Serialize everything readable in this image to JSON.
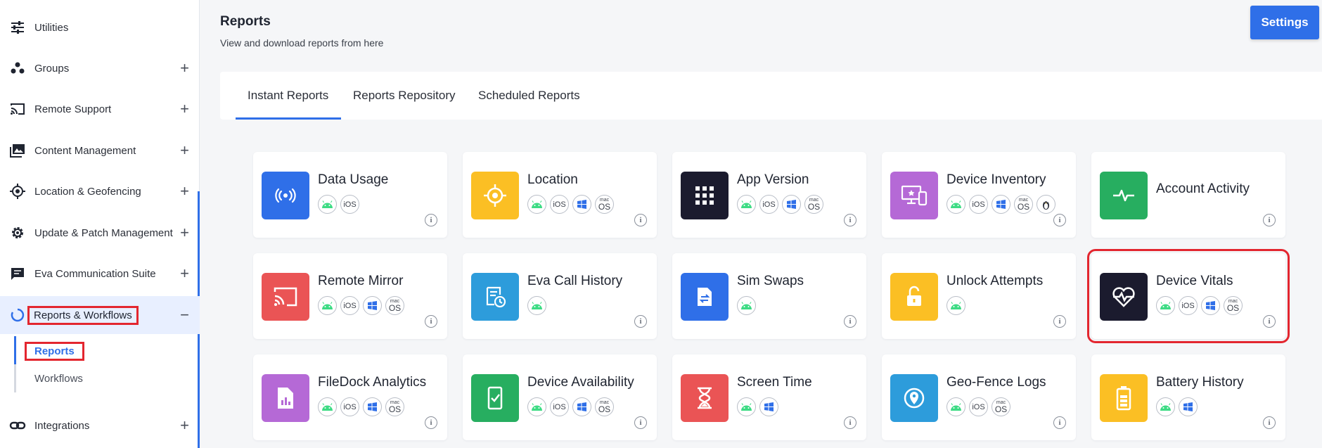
{
  "sidebar": {
    "items": [
      {
        "label": "Utilities",
        "icon": "sliders-icon",
        "expand": ""
      },
      {
        "label": "Groups",
        "icon": "groups-icon",
        "expand": "+"
      },
      {
        "label": "Remote Support",
        "icon": "cast-icon",
        "expand": "+"
      },
      {
        "label": "Content Management",
        "icon": "images-icon",
        "expand": "+"
      },
      {
        "label": "Location & Geofencing",
        "icon": "crosshair-icon",
        "expand": "+"
      },
      {
        "label": "Update & Patch Management",
        "icon": "gear-icon",
        "expand": "+"
      },
      {
        "label": "Eva Communication Suite",
        "icon": "chat-icon",
        "expand": "+"
      },
      {
        "label": "Reports & Workflows",
        "icon": "spinner-icon",
        "expand": "−"
      },
      {
        "label": "Integrations",
        "icon": "link-icon",
        "expand": "+"
      }
    ],
    "subitems": [
      {
        "label": "Reports"
      },
      {
        "label": "Workflows"
      }
    ]
  },
  "header": {
    "title": "Reports",
    "subtitle": "View and download reports from here",
    "settings_label": "Settings"
  },
  "tabs": [
    {
      "label": "Instant Reports"
    },
    {
      "label": "Reports Repository"
    },
    {
      "label": "Scheduled Reports"
    }
  ],
  "platform_labels": {
    "ios": "iOS",
    "mac_small": "mac",
    "mac_big": "OS"
  },
  "colors": {
    "accent": "#2f6fe8",
    "highlight": "#e3262f",
    "blue": "#2f6fe8",
    "yellow": "#fbbf24",
    "dark": "#1b1b2e",
    "purple": "#b569d6",
    "green": "#27ae60",
    "red": "#ea5455",
    "lightblue": "#2d9cdb",
    "android": "#3ddc84"
  },
  "info_glyph": "i",
  "cards": [
    {
      "title": "Data Usage",
      "color": "blue",
      "icon": "signal-broadcast-icon",
      "platforms": [
        "android",
        "ios"
      ]
    },
    {
      "title": "Location",
      "color": "yellow",
      "icon": "target-icon",
      "platforms": [
        "android",
        "ios",
        "windows",
        "macos"
      ]
    },
    {
      "title": "App Version",
      "color": "dark",
      "icon": "app-grid-icon",
      "platforms": [
        "android",
        "ios",
        "windows",
        "macos"
      ]
    },
    {
      "title": "Device Inventory",
      "color": "purple",
      "icon": "devices-icon",
      "platforms": [
        "android",
        "ios",
        "windows",
        "macos",
        "linux"
      ]
    },
    {
      "title": "Account Activity",
      "color": "green",
      "icon": "pulse-icon",
      "platforms": []
    },
    {
      "title": "Remote Mirror",
      "color": "red",
      "icon": "cast-icon",
      "platforms": [
        "android",
        "ios",
        "windows",
        "macos"
      ]
    },
    {
      "title": "Eva Call History",
      "color": "lightblue",
      "icon": "call-history-icon",
      "platforms": [
        "android"
      ]
    },
    {
      "title": "Sim Swaps",
      "color": "blue",
      "icon": "sim-swap-icon",
      "platforms": [
        "android"
      ]
    },
    {
      "title": "Unlock Attempts",
      "color": "yellow",
      "icon": "unlock-icon",
      "platforms": [
        "android"
      ]
    },
    {
      "title": "Device Vitals",
      "color": "dark",
      "icon": "heart-pulse-icon",
      "platforms": [
        "android",
        "ios",
        "windows",
        "macos"
      ],
      "highlighted": true
    },
    {
      "title": "FileDock Analytics",
      "color": "purple",
      "icon": "file-chart-icon",
      "platforms": [
        "android",
        "ios",
        "windows",
        "macos"
      ]
    },
    {
      "title": "Device Availability",
      "color": "green",
      "icon": "phone-check-icon",
      "platforms": [
        "android",
        "ios",
        "windows",
        "macos"
      ]
    },
    {
      "title": "Screen Time",
      "color": "red",
      "icon": "hourglass-icon",
      "platforms": [
        "android",
        "windows"
      ]
    },
    {
      "title": "Geo-Fence Logs",
      "color": "lightblue",
      "icon": "geo-pin-icon",
      "platforms": [
        "android",
        "ios",
        "macos"
      ]
    },
    {
      "title": "Battery History",
      "color": "yellow",
      "icon": "battery-icon",
      "platforms": [
        "android",
        "windows"
      ]
    }
  ]
}
